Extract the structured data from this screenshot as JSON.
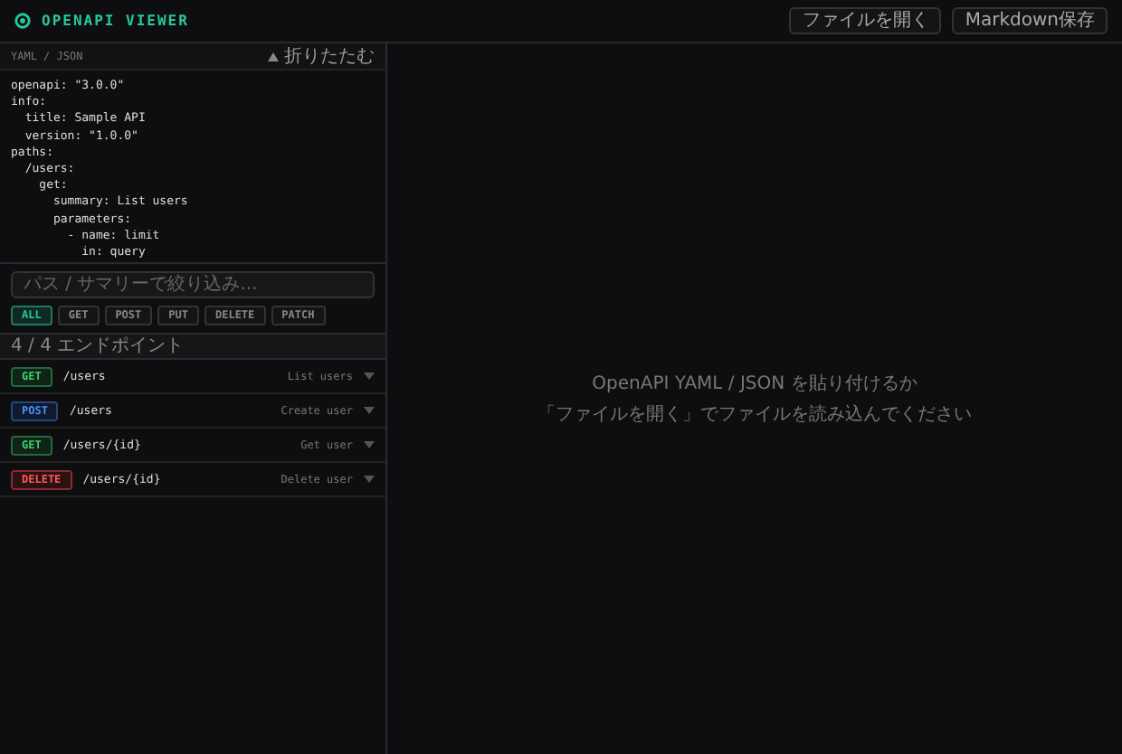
{
  "app": {
    "title": "OPENAPI VIEWER"
  },
  "header_buttons": [
    {
      "label": "ファイルを開く"
    },
    {
      "label": "Markdown保存"
    }
  ],
  "editor": {
    "label": "YAML / JSON",
    "collapse_label": "折りたたむ",
    "lines": [
      "openapi: \"3.0.0\"",
      "info:",
      "  title: Sample API",
      "  version: \"1.0.0\"",
      "paths:",
      "  /users:",
      "    get:",
      "      summary: List users",
      "      parameters:",
      "        - name: limit",
      "          in: query"
    ]
  },
  "search": {
    "placeholder": "パス / サマリーで絞り込み..."
  },
  "filters": [
    {
      "label": "ALL",
      "selected": true
    },
    {
      "label": "GET",
      "selected": false
    },
    {
      "label": "POST",
      "selected": false
    },
    {
      "label": "PUT",
      "selected": false
    },
    {
      "label": "DELETE",
      "selected": false
    },
    {
      "label": "PATCH",
      "selected": false
    }
  ],
  "count": "4 / 4 エンドポイント",
  "endpoints": [
    {
      "method": "GET",
      "kind": "get",
      "path": "/users",
      "summary": "List users"
    },
    {
      "method": "POST",
      "kind": "post",
      "path": "/users",
      "summary": "Create user"
    },
    {
      "method": "GET",
      "kind": "get",
      "path": "/users/{id}",
      "summary": "Get user"
    },
    {
      "method": "DELETE",
      "kind": "delete",
      "path": "/users/{id}",
      "summary": "Delete user"
    }
  ],
  "empty_message": [
    "OpenAPI YAML / JSON を貼り付けるか",
    "「ファイルを開く」でファイルを読み込んでください"
  ]
}
